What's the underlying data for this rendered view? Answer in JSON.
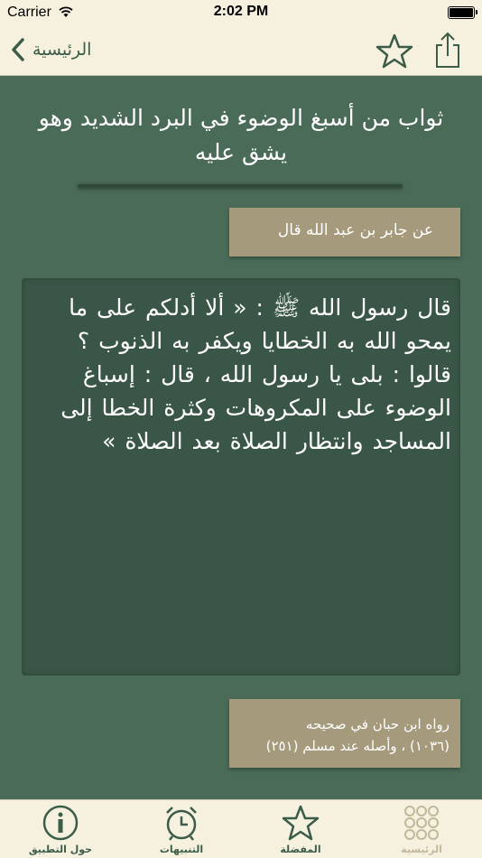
{
  "status_bar": {
    "carrier": "Carrier",
    "time": "2:02 PM"
  },
  "nav": {
    "back_label": "الرئيسية",
    "icons": [
      "chevron-left-icon",
      "star-icon",
      "share-icon"
    ]
  },
  "content": {
    "title": "ثواب من أسبغ الوضوء في البرد الشديد وهو يشق عليه",
    "narrator": "عن جابر بن عبد الله قال",
    "hadith": "قال رسول الله ﷺ : « ألا أدلكم على ما يمحو الله به الخطايا ويكفر به الذنوب ؟ قالوا : بلى يا رسول الله ، قال : إسباغ الوضوء على المكروهات وكثرة الخطا إلى المساجد وانتظار الصلاة بعد الصلاة »",
    "source_line1": "رواه ابن حبان في صحيحه",
    "source_line2": "(١٠٣٦) ، وأصله عند مسلم (٢٥١)"
  },
  "tabs": [
    {
      "label": "حول التطبيق",
      "icon": "info-icon"
    },
    {
      "label": "التنبيهات",
      "icon": "alarm-clock-icon"
    },
    {
      "label": "المفضلة",
      "icon": "star-icon"
    },
    {
      "label": "الرئيسية",
      "icon": "grid-icon",
      "selected": true
    }
  ],
  "colors": {
    "background": "#4a6b57",
    "bar": "#f6f1df",
    "accent": "#3b5c48",
    "box": "#a59a7c",
    "hadith_box": "#395646"
  }
}
